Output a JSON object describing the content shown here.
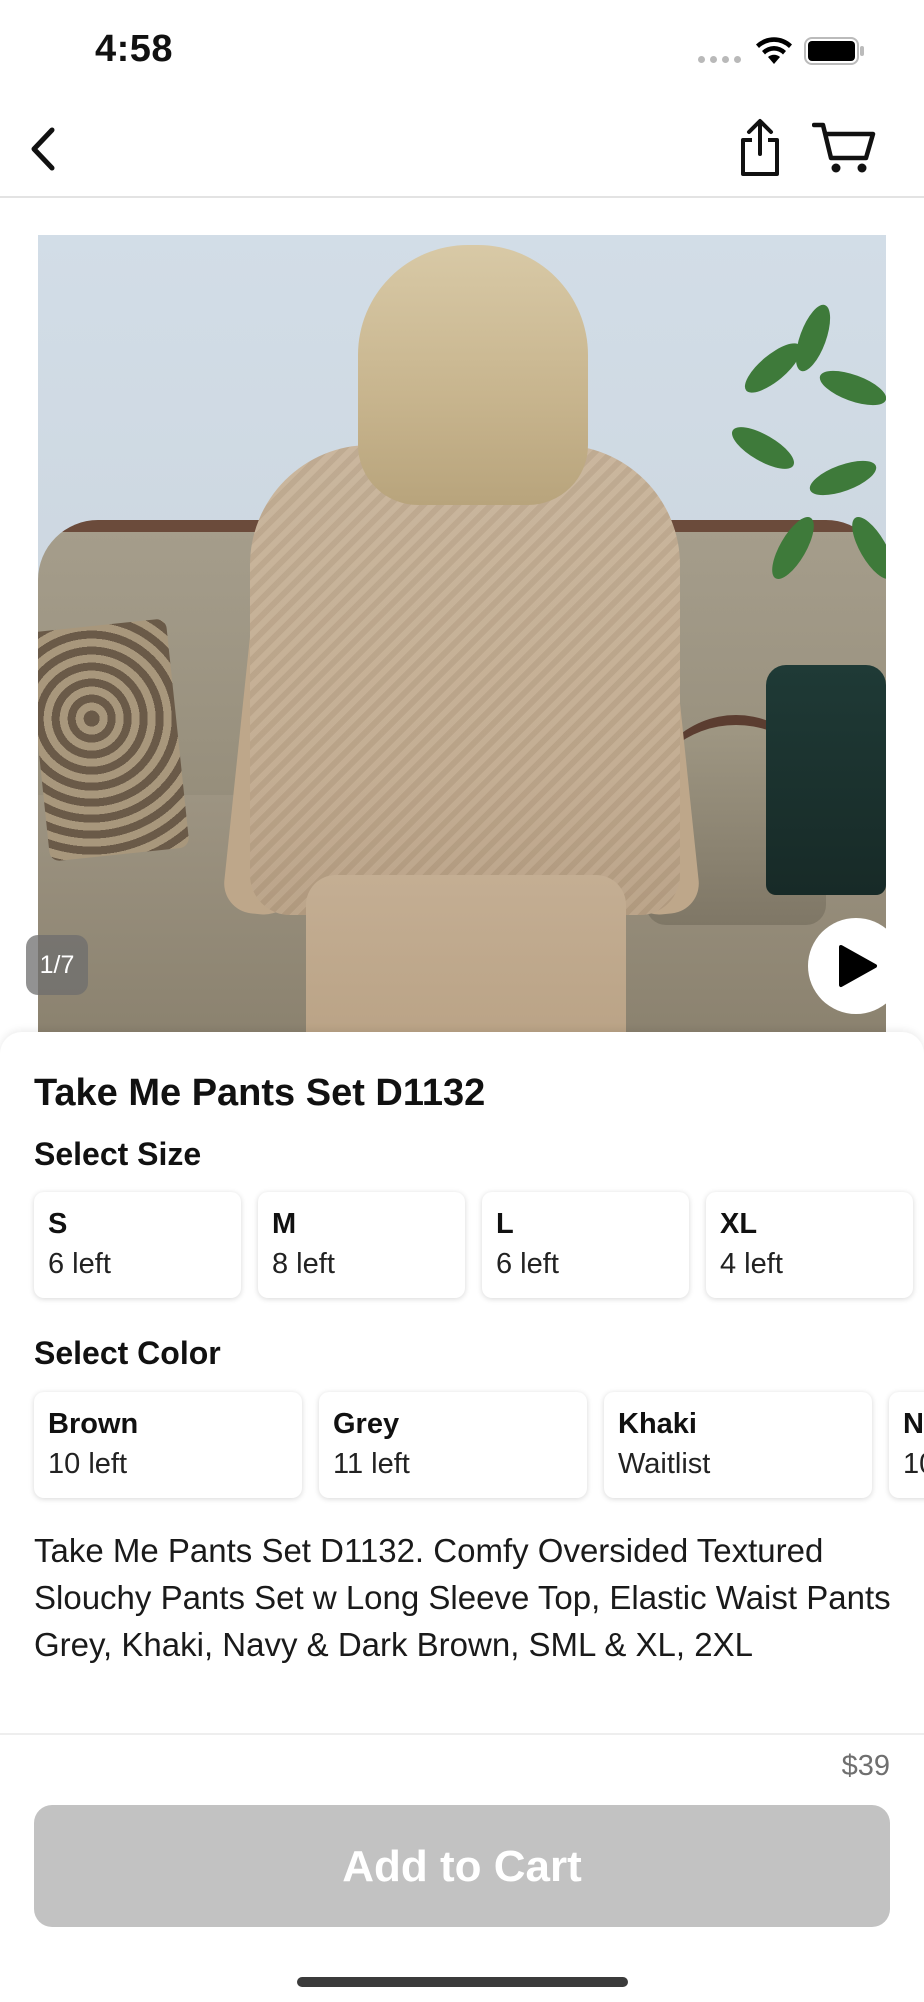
{
  "status_bar": {
    "time": "4:58"
  },
  "product": {
    "title": "Take Me Pants Set D1132",
    "image_counter": "1/7",
    "price": "$39",
    "description_lines": [
      "Take Me Pants Set D1132. Comfy Oversided Textured Slouchy Pants Set w Long Sleeve Top, Elastic Waist Pants",
      "Grey, Khaki, Navy & Dark Brown, SML & XL, 2XL"
    ]
  },
  "size": {
    "label": "Select Size",
    "options": [
      {
        "name": "S",
        "stock": "6 left"
      },
      {
        "name": "M",
        "stock": "8 left"
      },
      {
        "name": "L",
        "stock": "6 left"
      },
      {
        "name": "XL",
        "stock": "4 left"
      }
    ]
  },
  "color": {
    "label": "Select Color",
    "options": [
      {
        "name": "Brown",
        "stock": "10 left"
      },
      {
        "name": "Grey",
        "stock": "11 left"
      },
      {
        "name": "Khaki",
        "stock": "Waitlist"
      },
      {
        "name": "N",
        "stock": "10"
      }
    ]
  },
  "actions": {
    "add_to_cart": "Add to Cart"
  },
  "icons": {
    "back": "chevron-left-icon",
    "share": "share-icon",
    "cart": "cart-icon",
    "play": "play-icon"
  }
}
